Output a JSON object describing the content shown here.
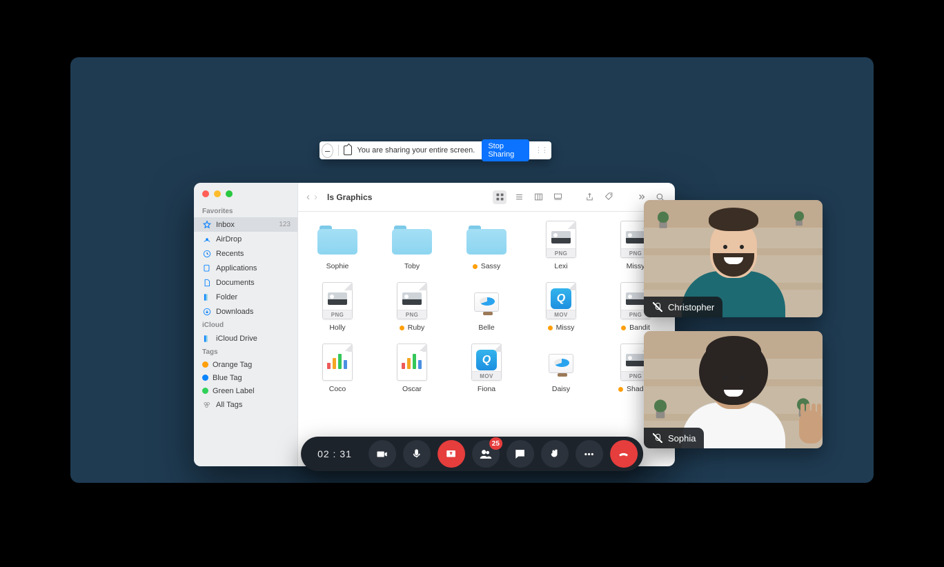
{
  "share_bar": {
    "message": "You are sharing your entire screen.",
    "button": "Stop Sharing"
  },
  "finder": {
    "title": "ls Graphics",
    "sidebar": {
      "favorites_header": "Favorites",
      "icloud_header": "iCloud",
      "tags_header": "Tags",
      "items": [
        {
          "label": "Inbox",
          "count": "123"
        },
        {
          "label": "AirDrop"
        },
        {
          "label": "Recents"
        },
        {
          "label": "Applications"
        },
        {
          "label": "Documents"
        },
        {
          "label": "Folder"
        },
        {
          "label": "Downloads"
        }
      ],
      "icloud": [
        {
          "label": "iCloud Drive"
        }
      ],
      "tags": [
        {
          "label": "Orange Tag"
        },
        {
          "label": "Blue Tag"
        },
        {
          "label": "Green Label"
        },
        {
          "label": "All Tags"
        }
      ]
    },
    "items": [
      {
        "kind": "folder",
        "name": "Sophie",
        "tag": null
      },
      {
        "kind": "folder",
        "name": "Toby",
        "tag": null
      },
      {
        "kind": "folder",
        "name": "Sassy",
        "tag": "orange"
      },
      {
        "kind": "png",
        "name": "Lexi",
        "tag": null
      },
      {
        "kind": "png",
        "name": "Missy",
        "tag": null
      },
      {
        "kind": "png",
        "name": "Holly",
        "tag": null
      },
      {
        "kind": "png",
        "name": "Ruby",
        "tag": "orange"
      },
      {
        "kind": "keynote",
        "name": "Belle",
        "tag": null
      },
      {
        "kind": "mov",
        "name": "Missy",
        "tag": "orange"
      },
      {
        "kind": "png",
        "name": "Bandit",
        "tag": "orange"
      },
      {
        "kind": "chart",
        "name": "Coco",
        "tag": null
      },
      {
        "kind": "chart",
        "name": "Oscar",
        "tag": null
      },
      {
        "kind": "mov",
        "name": "Fiona",
        "tag": null
      },
      {
        "kind": "keynote",
        "name": "Daisy",
        "tag": null
      },
      {
        "kind": "png",
        "name": "Shadow",
        "tag": "orange"
      }
    ]
  },
  "participants": [
    {
      "name": "Christopher",
      "mic_muted": true
    },
    {
      "name": "Sophia",
      "mic_muted": true
    }
  ],
  "callbar": {
    "timer": "02 : 31",
    "participants_badge": "25"
  }
}
